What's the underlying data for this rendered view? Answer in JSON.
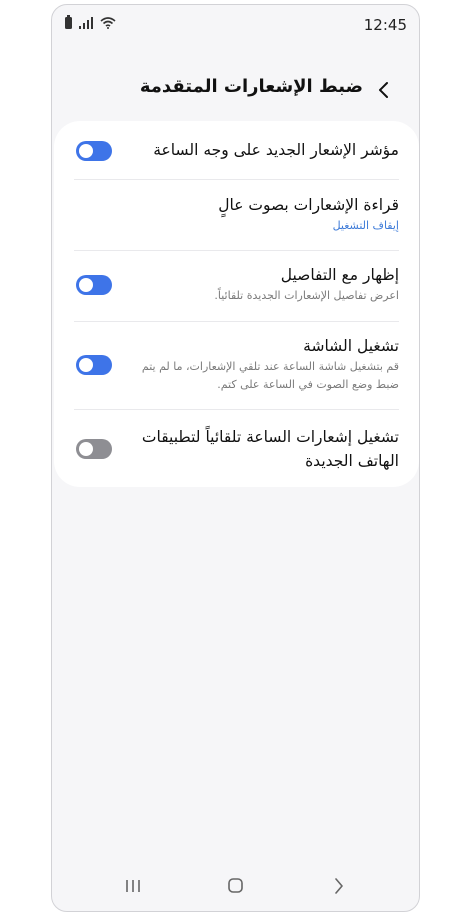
{
  "status_bar": {
    "time": "12:45",
    "icons": [
      "battery-icon",
      "signal-icon",
      "wifi-icon"
    ]
  },
  "header": {
    "title": "ضبط الإشعارات المتقدمة",
    "back_icon": "chevron-left-icon"
  },
  "settings": [
    {
      "title": "مؤشر الإشعار الجديد على وجه الساعة",
      "toggle": "on"
    },
    {
      "title": "قراءة الإشعارات بصوت عالٍ",
      "subtitle": "إيقاف التشغيل"
    },
    {
      "title": "إظهار مع التفاصيل",
      "subtitle": "اعرض تفاصيل الإشعارات الجديدة تلقائياً.",
      "toggle": "on"
    },
    {
      "title": "تشغيل الشاشة",
      "subtitle_lines": [
        "قم بتشغيل شاشة الساعة عند تلقي الإشعارات، ما لم يتم",
        "ضبط وضع الصوت في الساعة على كتم."
      ],
      "toggle": "on"
    },
    {
      "title_lines": [
        "تشغيل إشعارات الساعة تلقائياً لتطبيقات",
        "الهاتف الجديدة"
      ],
      "toggle": "off"
    }
  ],
  "nav_bar": {
    "icons": [
      "recent-apps-icon",
      "home-icon",
      "back-icon"
    ]
  },
  "colors": {
    "accent": "#3e74e8",
    "toggle_off": "#8e8e93",
    "link": "#3e7bd8",
    "background": "#f6f6f8",
    "card": "#ffffff"
  }
}
